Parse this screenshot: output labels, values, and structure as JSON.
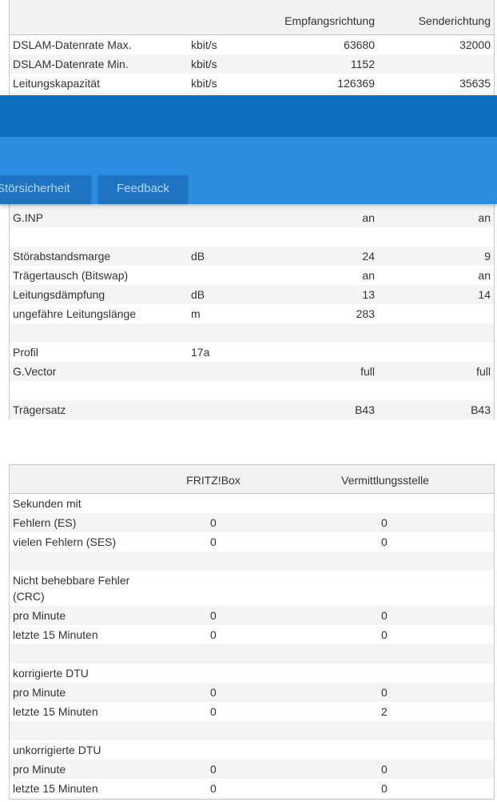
{
  "line_table": {
    "headers": {
      "downstream": "Empfangsrichtung",
      "upstream": "Senderichtung"
    },
    "rows": [
      {
        "label": "DSLAM-Datenrate Max.",
        "unit": "kbit/s",
        "down": "63680",
        "up": "32000"
      },
      {
        "label": "DSLAM-Datenrate Min.",
        "unit": "kbit/s",
        "down": "1152",
        "up": ""
      },
      {
        "label": "Leitungskapazität",
        "unit": "kbit/s",
        "down": "126369",
        "up": "35635"
      },
      {
        "label": "",
        "unit": "",
        "down": "",
        "up": ""
      },
      {
        "label": "",
        "unit": "",
        "down": "",
        "up": ""
      },
      {
        "label": "",
        "unit": "",
        "down": "",
        "up": ""
      },
      {
        "label": "",
        "unit": "",
        "down": "",
        "up": ""
      },
      {
        "label": "",
        "unit": "",
        "down": "",
        "up": ""
      },
      {
        "label": "",
        "unit": "",
        "down": "",
        "up": ""
      },
      {
        "label": "G.INP",
        "unit": "",
        "down": "an",
        "up": "an"
      },
      {
        "label": "",
        "unit": "",
        "down": "",
        "up": ""
      },
      {
        "label": "Störabstandsmarge",
        "unit": "dB",
        "down": "24",
        "up": "9"
      },
      {
        "label": "Trägertausch (Bitswap)",
        "unit": "",
        "down": "an",
        "up": "an"
      },
      {
        "label": "Leitungsdämpfung",
        "unit": "dB",
        "down": "13",
        "up": "14"
      },
      {
        "label": "ungefähre Leitungslänge",
        "unit": "m",
        "down": "283",
        "up": ""
      },
      {
        "label": "",
        "unit": "",
        "down": "",
        "up": ""
      },
      {
        "label": "Profil",
        "unit": "17a",
        "down": "",
        "up": ""
      },
      {
        "label": "G.Vector",
        "unit": "",
        "down": "full",
        "up": "full"
      },
      {
        "label": "",
        "unit": "",
        "down": "",
        "up": ""
      },
      {
        "label": "Trägersatz",
        "unit": "",
        "down": "B43",
        "up": "B43"
      }
    ]
  },
  "header_tabs": {
    "stoersicherheit": "Störsicherheit",
    "feedback": "Feedback"
  },
  "error_table": {
    "headers": {
      "fritzbox": "FRITZ!Box",
      "vst": "Vermittlungsstelle"
    },
    "rows": [
      {
        "label": "Sekunden mit",
        "fritzbox": "",
        "vst": ""
      },
      {
        "label": "Fehlern (ES)",
        "fritzbox": "0",
        "vst": "0"
      },
      {
        "label": "vielen Fehlern (SES)",
        "fritzbox": "0",
        "vst": "0"
      },
      {
        "label": "",
        "fritzbox": "",
        "vst": ""
      },
      {
        "label": "Nicht behebbare Fehler (CRC)",
        "fritzbox": "",
        "vst": ""
      },
      {
        "label": "pro Minute",
        "fritzbox": "0",
        "vst": "0"
      },
      {
        "label": "letzte 15 Minuten",
        "fritzbox": "0",
        "vst": "0"
      },
      {
        "label": "",
        "fritzbox": "",
        "vst": ""
      },
      {
        "label": "korrigierte DTU",
        "fritzbox": "",
        "vst": ""
      },
      {
        "label": "pro Minute",
        "fritzbox": "0",
        "vst": "0"
      },
      {
        "label": "letzte 15 Minuten",
        "fritzbox": "0",
        "vst": "2"
      },
      {
        "label": "",
        "fritzbox": "",
        "vst": ""
      },
      {
        "label": "unkorrigierte DTU",
        "fritzbox": "",
        "vst": ""
      },
      {
        "label": "pro Minute",
        "fritzbox": "0",
        "vst": "0"
      },
      {
        "label": "letzte 15 Minuten",
        "fritzbox": "0",
        "vst": "0"
      }
    ]
  }
}
